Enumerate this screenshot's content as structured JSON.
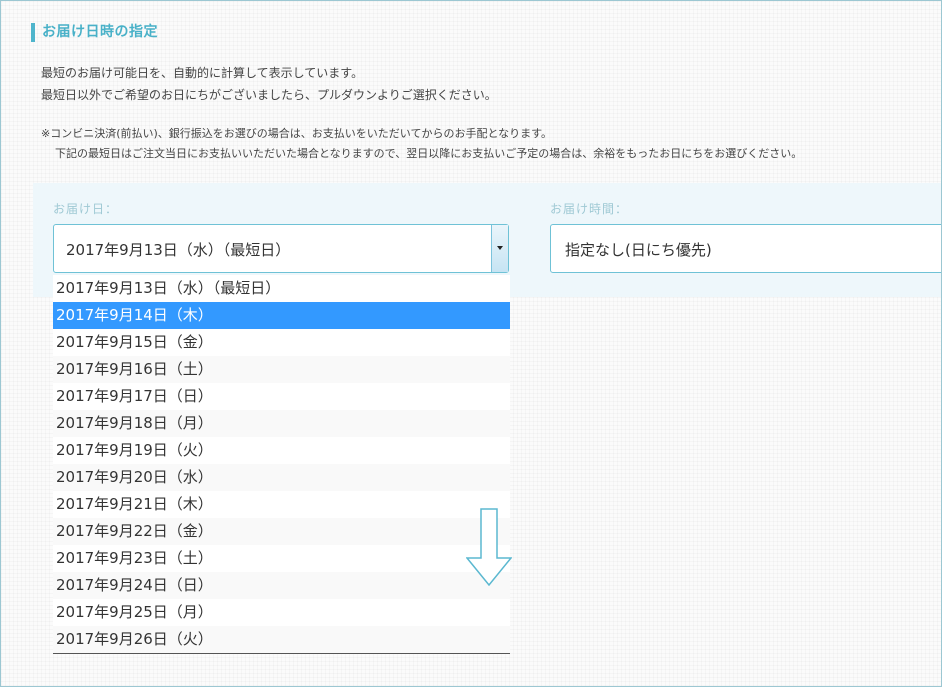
{
  "section": {
    "title": "お届け日時の指定"
  },
  "description": {
    "line1": "最短のお届け可能日を、自動的に計算して表示しています。",
    "line2": "最短日以外でご希望のお日にちがございましたら、プルダウンよりご選択ください。"
  },
  "note": {
    "line1": "※コンビニ決済(前払い)、銀行振込をお選びの場合は、お支払いをいただいてからのお手配となります。",
    "line2": "下記の最短日はご注文当日にお支払いいただいた場合となりますので、翌日以降にお支払いご予定の場合は、余裕をもったお日にちをお選びください。"
  },
  "delivery_date": {
    "label": "お届け日：",
    "value": "2017年9月13日（水）（最短日）",
    "selected_index": 1,
    "options": [
      "2017年9月13日（水）（最短日）",
      "2017年9月14日（木）",
      "2017年9月15日（金）",
      "2017年9月16日（土）",
      "2017年9月17日（日）",
      "2017年9月18日（月）",
      "2017年9月19日（火）",
      "2017年9月20日（水）",
      "2017年9月21日（木）",
      "2017年9月22日（金）",
      "2017年9月23日（土）",
      "2017年9月24日（日）",
      "2017年9月25日（月）",
      "2017年9月26日（火）"
    ]
  },
  "delivery_time": {
    "label": "お届け時間：",
    "value": "指定なし(日にち優先)"
  },
  "icons": {
    "dropdown_arrow": "chevron-down-icon",
    "scroll_hint": "arrow-down-icon"
  },
  "colors": {
    "accent": "#49b1c8",
    "selected": "#3399ff",
    "panel": "#eef7fb"
  }
}
